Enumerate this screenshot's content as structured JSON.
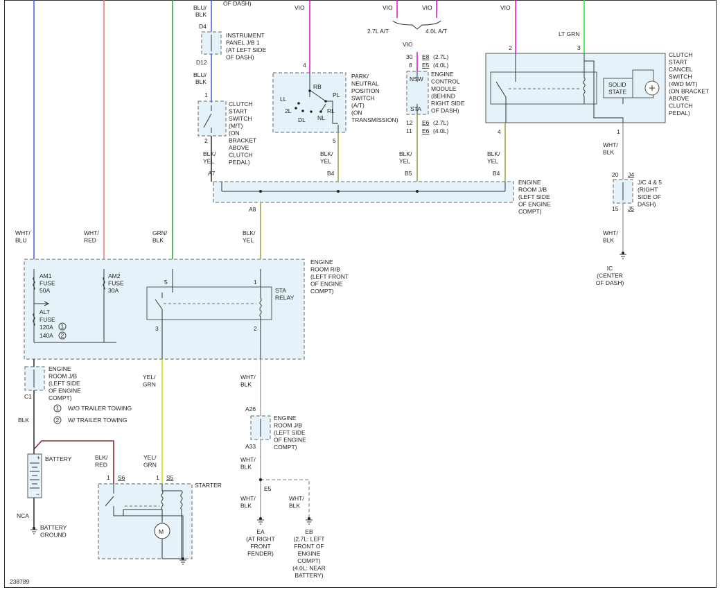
{
  "diagram_id": "238789",
  "colors": {
    "blu": "#5b5bf0",
    "red": "#e08080",
    "grn": "#3aa33a",
    "vio": "#e01ad2",
    "ltgrn": "#2ee62e",
    "yel": "#9aa64a",
    "gray": "#a9a9a9",
    "yelgrn": "#c8dc14",
    "dkred": "#8b2a2a",
    "black": "#333333"
  },
  "labels": {
    "top_of_dash": "OF DASH)",
    "blu_blk_1a": "BLU/",
    "blu_blk_1b": "BLK",
    "d4": "D4",
    "d12": "D12",
    "inst_panel": [
      "INSTRUMENT",
      "PANEL J/B 1",
      "(AT LEFT SIDE",
      "OF DASH)"
    ],
    "blu_blk_2a": "BLU/",
    "blu_blk_2b": "BLK",
    "clutch_start_pin1": "1",
    "clutch_start_pin2": "2",
    "clutch_start": [
      "CLUTCH",
      "START",
      "SWITCH",
      "(M/T)",
      "(ON",
      "BRACKET",
      "ABOVE",
      "CLUTCH",
      "PEDAL)"
    ],
    "vio1": "VIO",
    "pin4_pn": "4",
    "pn_switch": [
      "PARK/",
      "NEUTRAL",
      "POSITION",
      "SWITCH",
      "(A/T)",
      "(ON",
      "TRANSMISSION)"
    ],
    "pn_rb": "RB",
    "pn_pl": "PL",
    "pn_ll": "LL",
    "pn_2l": "2L",
    "pn_rl": "RL",
    "pn_dl": "DL",
    "pn_nl": "NL",
    "pin5_pn": "5",
    "vio_27": "VIO",
    "vio_40": "VIO",
    "at_27": "2.7L A/T",
    "at_40": "4.0L A/T",
    "vio_ecm": "VIO",
    "ecm_p30": "30",
    "ecm_e8": "E8",
    "ecm_27a": "(2.7L)",
    "ecm_p8": "8",
    "ecm_e5": "E5",
    "ecm_40a": "(4.0L)",
    "ecm_nsw": "NSW",
    "ecm_sta": "STA",
    "ecm": [
      "ENGINE",
      "CONTROL",
      "MODULE",
      "(BEHIND",
      "RIGHT SIDE",
      "OF DASH)"
    ],
    "ecm_p12": "12",
    "ecm_e6a": "E6",
    "ecm_27b": "(2.7L)",
    "ecm_p11": "11",
    "ecm_e6b": "E6",
    "ecm_40b": "(4.0L)",
    "vio_ccs": "VIO",
    "ltgrn": "LT GRN",
    "ccs_p2": "2",
    "ccs_p3": "3",
    "ccs_p4": "4",
    "ccs_p1": "1",
    "solid_state": [
      "SOLID",
      "STATE"
    ],
    "ccs": [
      "CLUTCH",
      "START",
      "CANCEL",
      "SWITCH",
      "(4WD M/T)",
      "(ON BRACKET",
      "ABOVE",
      "CLUTCH",
      "PEDAL)"
    ],
    "blkyel_a7": [
      "BLK/",
      "YEL"
    ],
    "blkyel_b4": [
      "BLK/",
      "YEL"
    ],
    "blkyel_b5": [
      "BLK/",
      "YEL"
    ],
    "blkyel_b4r": [
      "BLK/",
      "YEL"
    ],
    "a7": "A7",
    "b4": "B4",
    "b5": "B5",
    "b4r": "B4",
    "a8": "A8",
    "erjb_top": [
      "ENGINE",
      "ROOM J/B",
      "(LEFT SIDE",
      "OF ENGINE",
      "COMPT)"
    ],
    "whtblk_jc": [
      "WHT/",
      "BLK"
    ],
    "jc_20": "20",
    "jc_j4": "J4",
    "jc_15": "15",
    "jc_j5": "J5",
    "jc": [
      "J/C 4 & 5",
      "(RIGHT",
      "SIDE OF",
      "DASH)"
    ],
    "whtblk_ic": [
      "WHT/",
      "BLK"
    ],
    "ic": [
      "IC",
      "(CENTER",
      "OF DASH)"
    ],
    "whtblu": [
      "WHT/",
      "BLU"
    ],
    "whtred": [
      "WHT/",
      "RED"
    ],
    "grnblk": [
      "GRN/",
      "BLK"
    ],
    "blkyel_a8": [
      "BLK/",
      "YEL"
    ],
    "errb": [
      "ENGINE",
      "ROOM R/B",
      "(LEFT FRONT",
      "OF ENGINE",
      "COMPT)"
    ],
    "am1": [
      "AM1",
      "FUSE",
      "50A"
    ],
    "am2": [
      "AM2",
      "FUSE",
      "30A"
    ],
    "alt": [
      "ALT",
      "FUSE",
      "120A",
      "140A"
    ],
    "circ1": "1",
    "circ2": "2",
    "sta_relay": [
      "STA",
      "RELAY"
    ],
    "relay_5": "5",
    "relay_1": "1",
    "relay_3": "3",
    "relay_2": "2",
    "erjb_c1": [
      "ENGINE",
      "ROOM J/B",
      "(LEFT SIDE",
      "OF ENGINE",
      "COMPT)"
    ],
    "c1": "C1",
    "note1": "W/O TRAILER TOWING",
    "note2": "W/ TRAILER TOWING",
    "blk": "BLK",
    "battery": "BATTERY",
    "nca": "NCA",
    "batt_ground": [
      "BATTERY",
      "GROUND"
    ],
    "yelgrn1": [
      "YEL/",
      "GRN"
    ],
    "whtblk_relay": [
      "WHT/",
      "BLK"
    ],
    "a26": "A26",
    "a33": "A33",
    "erjb_a26": [
      "ENGINE",
      "ROOM J/B",
      "(LEFT SIDE",
      "OF ENGINE",
      "COMPT)"
    ],
    "whtblk_e5": [
      "WHT/",
      "BLK"
    ],
    "e5": "E5",
    "blkred": [
      "BLK/",
      "RED"
    ],
    "yelgrn2": [
      "YEL/",
      "GRN"
    ],
    "s6_pin": "1",
    "s6": "S6",
    "s5_pin": "1",
    "s5": "S5",
    "starter": "STARTER",
    "motor": "M",
    "whtblk_ea": [
      "WHT/",
      "BLK"
    ],
    "whtblk_eb": [
      "WHT/",
      "BLK"
    ],
    "ea": [
      "EA",
      "(AT RIGHT",
      "FRONT",
      "FENDER)"
    ],
    "eb": [
      "EB",
      "(2.7L: LEFT",
      "FRONT OF",
      "ENGINE",
      "COMPT)",
      "(4.0L: NEAR",
      "BATTERY)"
    ],
    "battery_plus": "+",
    "battery_minus": "−"
  }
}
